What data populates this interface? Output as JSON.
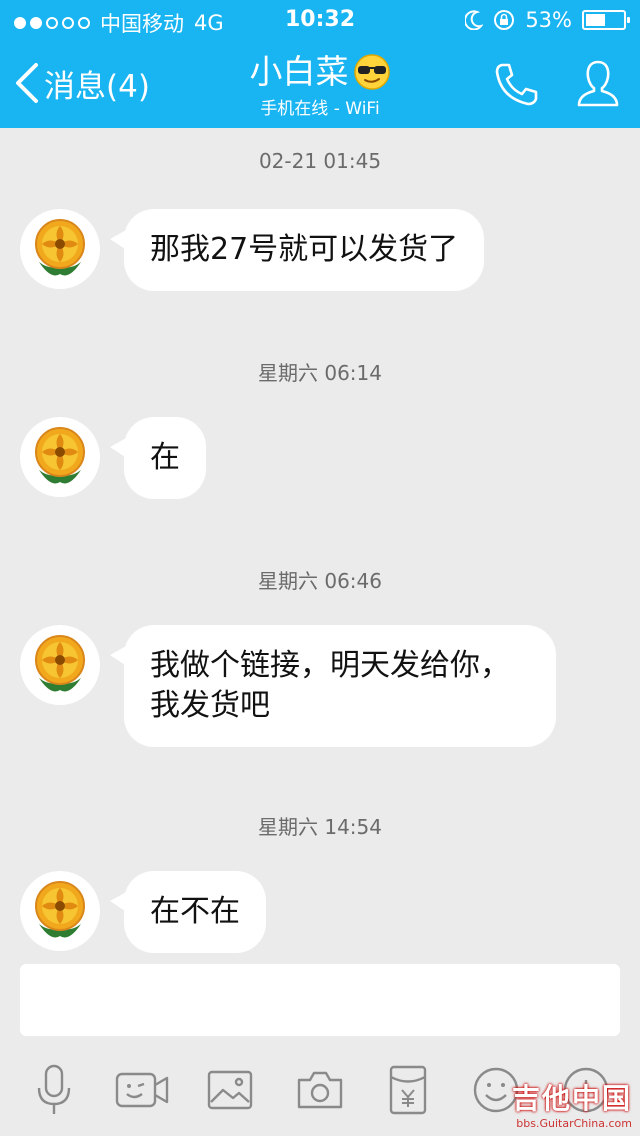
{
  "status_bar": {
    "carrier": "中国移动",
    "network": "4G",
    "time": "10:32",
    "battery": "53%",
    "battery_level": 0.53
  },
  "header": {
    "back_label": "消息(4)",
    "title": "小白菜",
    "subtitle": "手机在线 - WiFi"
  },
  "messages": [
    {
      "time": "02-21 01:45",
      "text": "那我27号就可以发货了"
    },
    {
      "time": "星期六 06:14",
      "text": "在"
    },
    {
      "time": "星期六 06:46",
      "line1": "我做个链接，明天发给你，",
      "line2": "我发货吧"
    },
    {
      "time": "星期六 14:54",
      "text": "在不在"
    }
  ],
  "toolbar": {
    "icons": [
      "microphone-icon",
      "video-call-icon",
      "image-icon",
      "camera-icon",
      "red-packet-icon",
      "emoji-icon",
      "plus-icon"
    ]
  },
  "watermark": {
    "main": "吉他中国",
    "sub": "bbs.GuitarChina.com"
  },
  "colors": {
    "header": "#19b4f2",
    "background": "#ebebeb",
    "bubble": "#ffffff"
  }
}
